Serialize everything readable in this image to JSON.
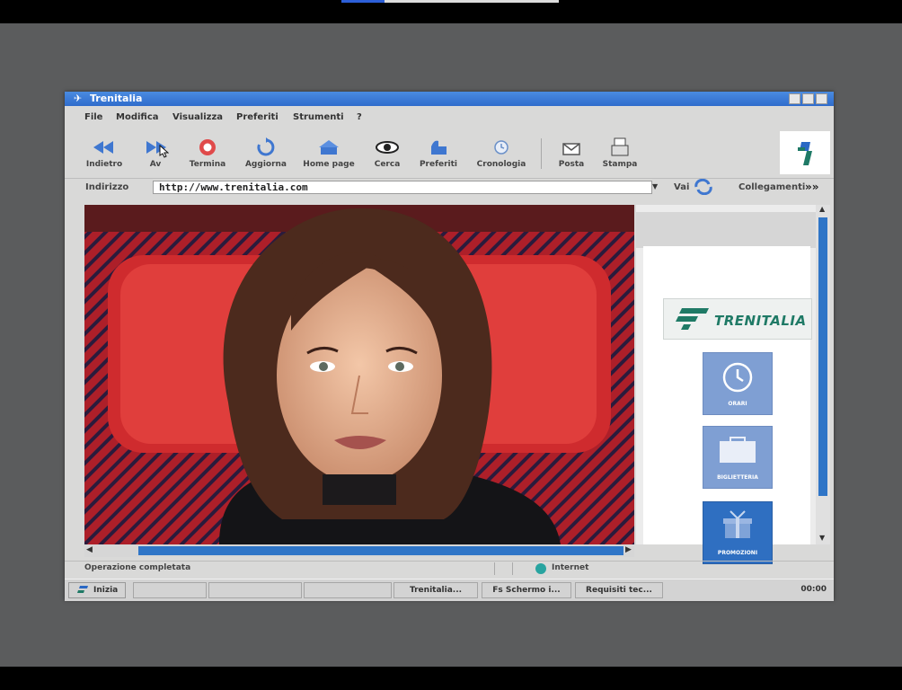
{
  "window": {
    "title": "Trenitalia"
  },
  "menu": [
    "File",
    "Modifica",
    "Visualizza",
    "Preferiti",
    "Strumenti",
    "?"
  ],
  "toolbar": {
    "buttons": [
      {
        "label": "Indietro",
        "icon": "back-icon"
      },
      {
        "label": "Av",
        "icon": "forward-icon"
      },
      {
        "label": "Termina",
        "icon": "stop-icon"
      },
      {
        "label": "Aggiorna",
        "icon": "refresh-icon"
      },
      {
        "label": "Home page",
        "icon": "home-icon"
      },
      {
        "label": "Cerca",
        "icon": "search-icon"
      },
      {
        "label": "Preferiti",
        "icon": "favorites-icon"
      },
      {
        "label": "Cronologia",
        "icon": "history-icon"
      },
      {
        "label": "Posta",
        "icon": "mail-icon"
      },
      {
        "label": "Stampa",
        "icon": "print-icon"
      }
    ]
  },
  "address": {
    "label": "Indirizzo",
    "url": "http://www.trenitalia.com",
    "go_label": "Vai",
    "links_label": "Collegamenti",
    "links_arrows": "»»"
  },
  "sidepanel": {
    "logo": "TRENITALIA",
    "tiles": [
      {
        "label": "ORARI",
        "icon": "clock-icon"
      },
      {
        "label": "BIGLIETTERIA",
        "icon": "ticket-icon"
      },
      {
        "label": "PROMOZIONI",
        "icon": "gift-icon"
      }
    ]
  },
  "status": {
    "text": "Operazione completata",
    "zone": "Internet"
  },
  "taskbar": {
    "start_label": "Inizia",
    "tasks": [
      "Trenitalia...",
      "Fs Schermo i...",
      "Requisiti tec..."
    ],
    "clock": "00:00"
  },
  "colors": {
    "titlebar": "#2f6ccc",
    "scroll": "#2f75c7",
    "brand_green": "#1f7a66",
    "tile": "#7f9fd3"
  }
}
